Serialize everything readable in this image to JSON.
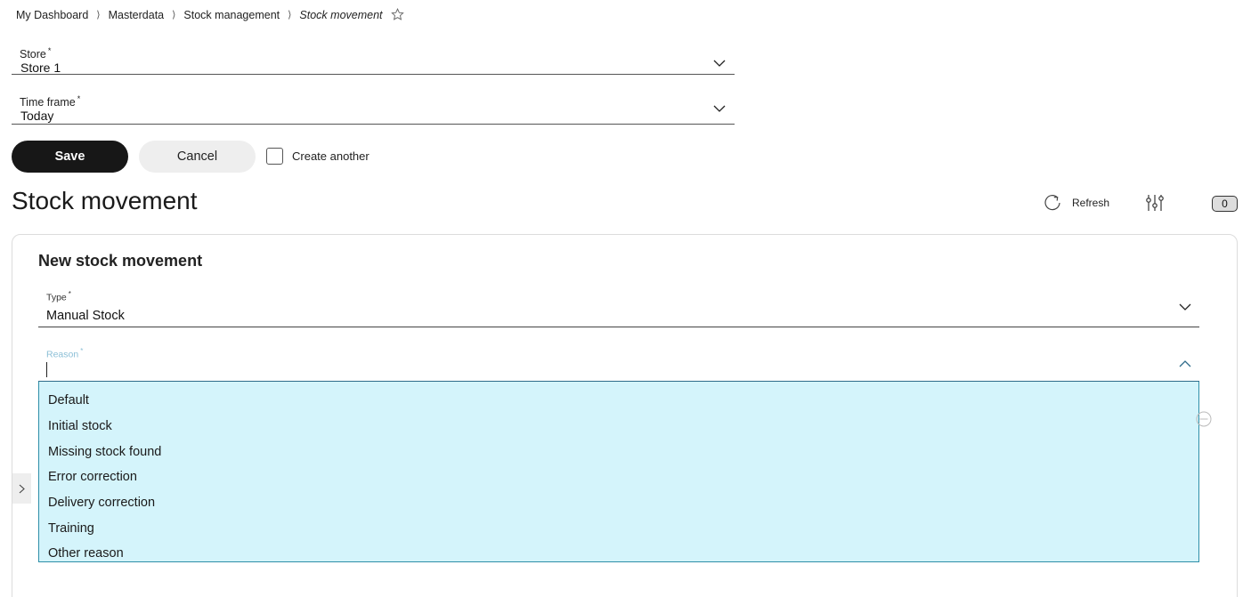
{
  "breadcrumb": {
    "items": [
      "My Dashboard",
      "Masterdata",
      "Stock management"
    ],
    "current": "Stock movement",
    "separator": "⟩"
  },
  "store": {
    "label": "Store",
    "required_mark": "*",
    "value": "Store 1"
  },
  "time_frame": {
    "label": "Time frame",
    "required_mark": "*",
    "value": "Today"
  },
  "actions": {
    "save_label": "Save",
    "cancel_label": "Cancel",
    "create_another_label": "Create another",
    "create_another_checked": false
  },
  "page": {
    "title": "Stock movement",
    "refresh_label": "Refresh",
    "count": "0"
  },
  "card": {
    "title": "New stock movement",
    "type": {
      "label": "Type",
      "required_mark": "*",
      "value": "Manual Stock"
    },
    "reason": {
      "label": "Reason",
      "required_mark": "*",
      "value": "",
      "options": [
        "Default",
        "Initial stock",
        "Missing stock found",
        "Error correction",
        "Delivery correction",
        "Training",
        "Other reason"
      ]
    }
  },
  "icons": {
    "star": "star-outline-icon",
    "chevron": "chevron-down-icon",
    "refresh": "refresh-icon",
    "filter": "sliders-icon",
    "side": "chevron-right-icon",
    "remove": "minus-circle-icon"
  },
  "colors": {
    "primary_button": "#171717",
    "dropdown_bg": "#d4f4fb",
    "focus_label": "#8bbfd6"
  }
}
